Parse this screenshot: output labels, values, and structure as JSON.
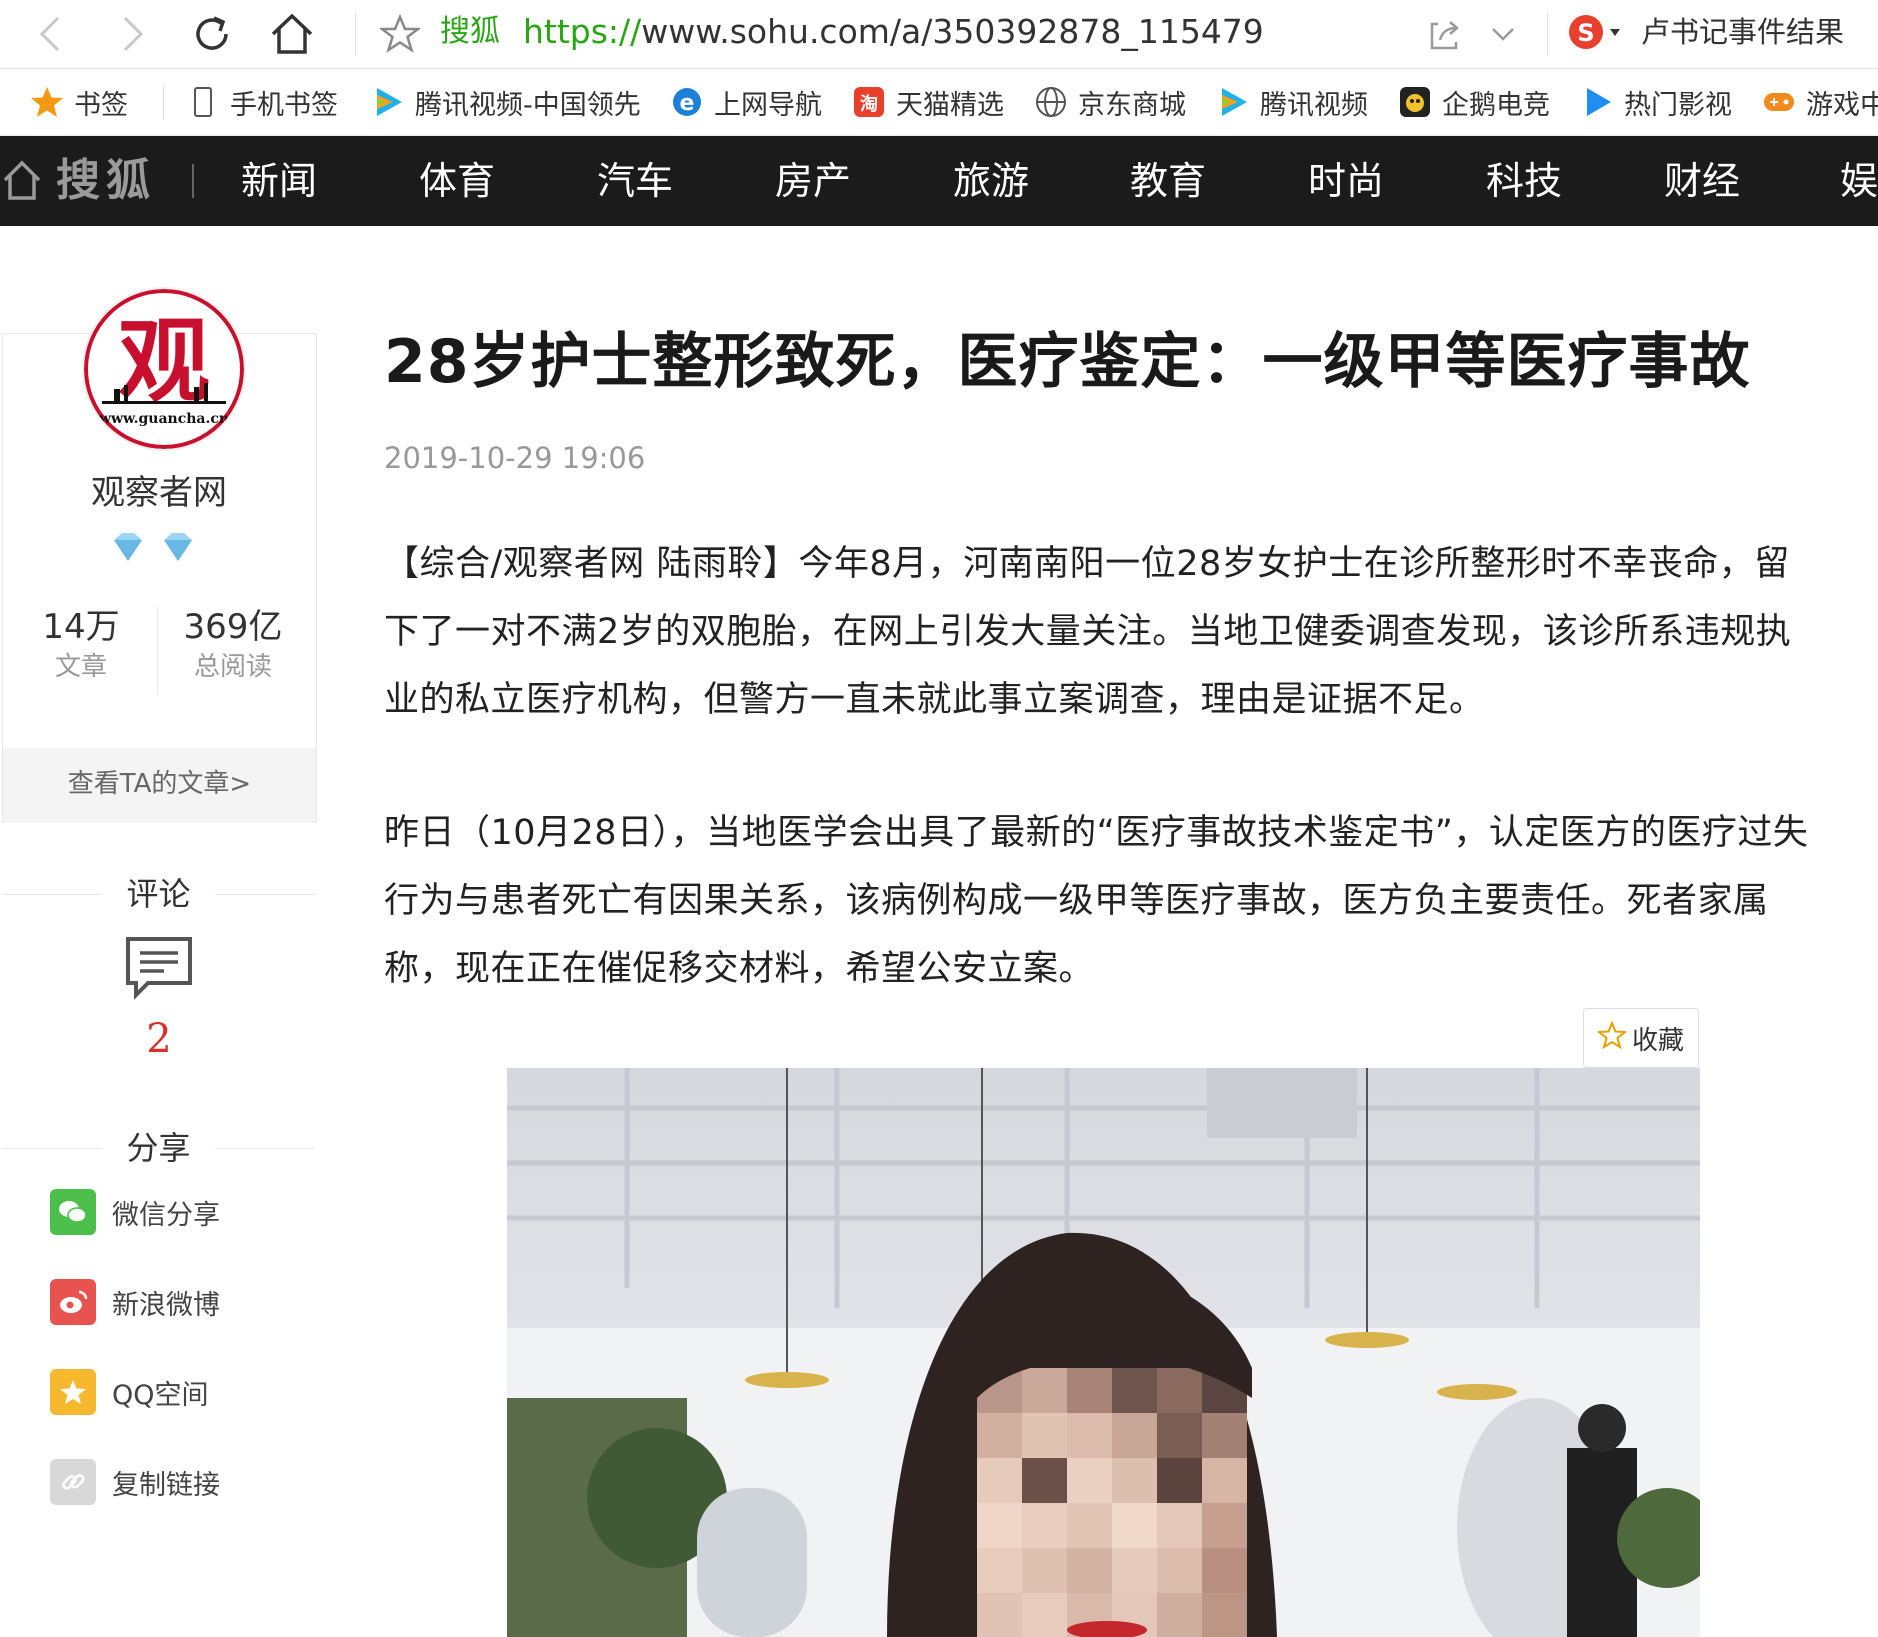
{
  "browser": {
    "site_label": "搜狐",
    "url_proto": "https://",
    "url_rest": "www.sohu.com/a/350392878_115479",
    "search_text": "卢书记事件结果"
  },
  "bookmarks": [
    {
      "label": "书签",
      "icon": "star-icon"
    },
    {
      "label": "手机书签",
      "icon": "phone-icon"
    },
    {
      "label": "腾讯视频-中国领先",
      "icon": "tencent-video-icon"
    },
    {
      "label": "上网导航",
      "icon": "ie-icon"
    },
    {
      "label": "天猫精选",
      "icon": "tmall-icon"
    },
    {
      "label": "京东商城",
      "icon": "globe-icon"
    },
    {
      "label": "腾讯视频",
      "icon": "tencent-video-icon"
    },
    {
      "label": "企鹅电竞",
      "icon": "penguin-icon"
    },
    {
      "label": "热门影视",
      "icon": "play-icon"
    },
    {
      "label": "游戏中",
      "icon": "gamepad-icon"
    }
  ],
  "sitenav": {
    "logo": "搜狐",
    "items": [
      "新闻",
      "体育",
      "汽车",
      "房产",
      "旅游",
      "教育",
      "时尚",
      "科技",
      "财经",
      "娱"
    ]
  },
  "author": {
    "name": "观察者网",
    "avatar_char": "观",
    "avatar_url_text": "www.guancha.cn",
    "articles_num": "14万",
    "articles_label": "文章",
    "reads_num": "369亿",
    "reads_label": "总阅读",
    "view_link": "查看TA的文章>"
  },
  "comments": {
    "heading": "评论",
    "count": "2"
  },
  "share": {
    "heading": "分享",
    "items": [
      {
        "label": "微信分享",
        "color": "#4cbf4a"
      },
      {
        "label": "新浪微博",
        "color": "#e8534f"
      },
      {
        "label": "QQ空间",
        "color": "#f5b82e"
      },
      {
        "label": "复制链接",
        "color": "#d8d8d8"
      }
    ]
  },
  "article": {
    "title": "28岁护士整形致死，医疗鉴定：一级甲等医疗事故",
    "date": "2019-10-29 19:06",
    "para1_lines": [
      "【综合/观察者网 陆雨聆】今年8月，河南南阳一位28岁女护士在诊所整形时不幸丧命，留",
      "下了一对不满2岁的双胞胎，在网上引发大量关注。当地卫健委调查发现，该诊所系违规执",
      "业的私立医疗机构，但警方一直未就此事立案调查，理由是证据不足。"
    ],
    "para2_lines": [
      "昨日（10月28日），当地医学会出具了最新的“医疗事故技术鉴定书”，认定医方的医疗过失",
      "行为与患者死亡有因果关系，该病例构成一级甲等医疗事故，医方负主要责任。死者家属",
      "称，现在正在催促移交材料，希望公安立案。"
    ],
    "favorite_label": "收藏"
  },
  "colors": {
    "nav_bg": "#1b1b1b",
    "accent_red": "#d9302c",
    "url_green": "#2aa515"
  }
}
